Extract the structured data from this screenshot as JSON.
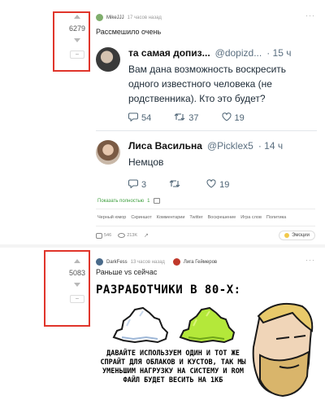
{
  "post1": {
    "score": "6279",
    "author": "MikeJJJ",
    "time": "17 часов назад",
    "title": "Рассмешило очень",
    "tweet1": {
      "name": "та самая допиз...",
      "handle": "@dopizd...",
      "time": "· 15 ч",
      "text": "Вам дана возможность воскресить одного известного человека (не родственника). Кто это будет?",
      "replies": "54",
      "retweets": "37",
      "likes": "19"
    },
    "tweet2": {
      "name": "Лиса Васильна",
      "handle": "@Picklex5",
      "time": "· 14 ч",
      "text": "Немцов",
      "replies": "3",
      "retweets": "",
      "likes": "19"
    },
    "show_full": "Показать полностью",
    "show_full_count": "1",
    "tags": [
      "Черный юмор",
      "Скриншот",
      "Комментарии",
      "Twitter",
      "Воскрешение",
      "Игра слов",
      "Политика"
    ],
    "footer": {
      "comments": "546",
      "views": "213K",
      "emotions": "Эмоции"
    }
  },
  "post2": {
    "score": "5083",
    "author": "DarkFess",
    "time": "13 часов назад",
    "community": "Лига Геймеров",
    "title": "Раньше vs сейчас",
    "meme_title": "РАЗРАБОТЧИКИ В 80-Х:",
    "meme_text": "ДАВАЙТЕ ИСПОЛЬЗУЕМ ОДИН И ТОТ ЖЕ СПРАЙТ ДЛЯ ОБЛАКОВ И КУСТОВ, ТАК МЫ УМЕНЬШИМ НАГРУЗКУ НА СИСТЕМУ И ROM ФАЙЛ БУДЕТ ВЕСИТЬ НА 1КБ"
  },
  "icons": {
    "up": "triangle-up",
    "down": "triangle-down",
    "reply": "speech-bubble",
    "retweet": "retweet-arrows",
    "like": "heart",
    "comments": "comment-bubble",
    "views": "eye",
    "share": "share-arrow",
    "emotions": "emoji-face"
  },
  "colors": {
    "highlight": "#e0352b",
    "link_green": "#3a9d3a",
    "cloud": "#ffffff",
    "bush": "#b4e83a"
  }
}
